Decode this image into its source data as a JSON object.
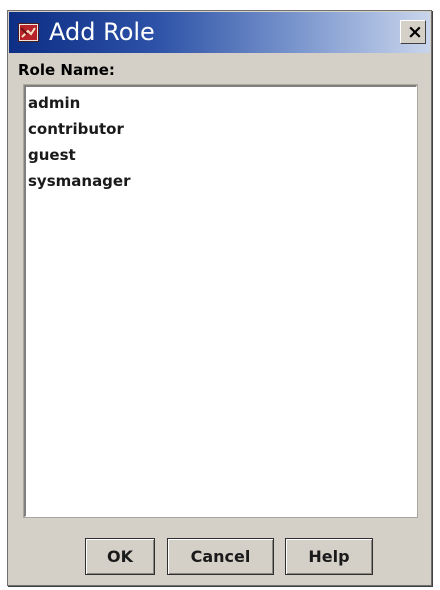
{
  "window": {
    "title": "Add Role",
    "icon": "role-app-icon",
    "close_label": "×"
  },
  "form": {
    "field_label": "Role Name:",
    "roles": [
      "admin",
      "contributor",
      "guest",
      "sysmanager"
    ]
  },
  "buttons": {
    "ok_label": "OK",
    "cancel_label": "Cancel",
    "help_label": "Help"
  },
  "colors": {
    "title_start": "#0c2e84",
    "title_end": "#c9d5ec",
    "dialog_bg": "#d4d0c8"
  }
}
